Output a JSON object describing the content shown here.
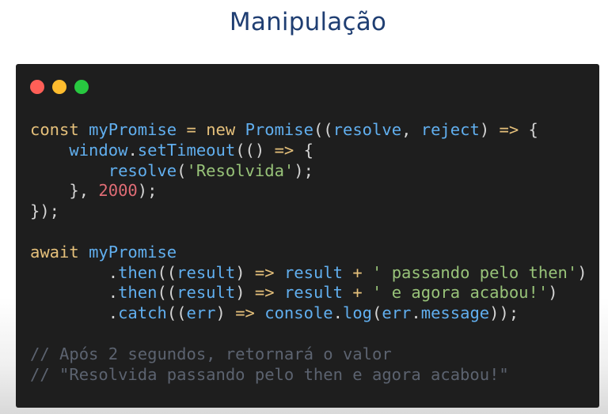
{
  "slide": {
    "title": "Manipulação"
  },
  "window": {
    "controls": {
      "close_color": "#ff5f57",
      "minimize_color": "#febc2e",
      "maximize_color": "#28c840"
    }
  },
  "colors": {
    "title": "#1f3e72",
    "code_background": "#1e1e1e",
    "keyword": "#e5c07b",
    "identifier": "#61afef",
    "string": "#98c379",
    "number": "#e06c75",
    "comment": "#5c6370"
  },
  "code": {
    "lines": [
      [
        {
          "t": "const",
          "c": "kw"
        },
        {
          "t": " ",
          "c": "pun"
        },
        {
          "t": "myPromise",
          "c": "var"
        },
        {
          "t": " ",
          "c": "pun"
        },
        {
          "t": "=",
          "c": "op"
        },
        {
          "t": " ",
          "c": "pun"
        },
        {
          "t": "new",
          "c": "kw"
        },
        {
          "t": " ",
          "c": "pun"
        },
        {
          "t": "Promise",
          "c": "cls"
        },
        {
          "t": "((",
          "c": "pun"
        },
        {
          "t": "resolve",
          "c": "var"
        },
        {
          "t": ", ",
          "c": "pun"
        },
        {
          "t": "reject",
          "c": "var"
        },
        {
          "t": ") ",
          "c": "pun"
        },
        {
          "t": "=>",
          "c": "op"
        },
        {
          "t": " {",
          "c": "pun"
        }
      ],
      [
        {
          "t": "    ",
          "c": "pun"
        },
        {
          "t": "window",
          "c": "var"
        },
        {
          "t": ".",
          "c": "pun"
        },
        {
          "t": "setTimeout",
          "c": "fn"
        },
        {
          "t": "(() ",
          "c": "pun"
        },
        {
          "t": "=>",
          "c": "op"
        },
        {
          "t": " {",
          "c": "pun"
        }
      ],
      [
        {
          "t": "        ",
          "c": "pun"
        },
        {
          "t": "resolve",
          "c": "fn"
        },
        {
          "t": "(",
          "c": "pun"
        },
        {
          "t": "'Resolvida'",
          "c": "str"
        },
        {
          "t": ");",
          "c": "pun"
        }
      ],
      [
        {
          "t": "    }, ",
          "c": "pun"
        },
        {
          "t": "2000",
          "c": "num"
        },
        {
          "t": ");",
          "c": "pun"
        }
      ],
      [
        {
          "t": "});",
          "c": "pun"
        }
      ],
      [],
      [
        {
          "t": "await",
          "c": "kw"
        },
        {
          "t": " ",
          "c": "pun"
        },
        {
          "t": "myPromise",
          "c": "var"
        }
      ],
      [
        {
          "t": "        .",
          "c": "pun"
        },
        {
          "t": "then",
          "c": "fn"
        },
        {
          "t": "((",
          "c": "pun"
        },
        {
          "t": "result",
          "c": "var"
        },
        {
          "t": ") ",
          "c": "pun"
        },
        {
          "t": "=>",
          "c": "op"
        },
        {
          "t": " ",
          "c": "pun"
        },
        {
          "t": "result",
          "c": "var"
        },
        {
          "t": " ",
          "c": "pun"
        },
        {
          "t": "+",
          "c": "op"
        },
        {
          "t": " ",
          "c": "pun"
        },
        {
          "t": "' passando pelo then'",
          "c": "str"
        },
        {
          "t": ")",
          "c": "pun"
        }
      ],
      [
        {
          "t": "        .",
          "c": "pun"
        },
        {
          "t": "then",
          "c": "fn"
        },
        {
          "t": "((",
          "c": "pun"
        },
        {
          "t": "result",
          "c": "var"
        },
        {
          "t": ") ",
          "c": "pun"
        },
        {
          "t": "=>",
          "c": "op"
        },
        {
          "t": " ",
          "c": "pun"
        },
        {
          "t": "result",
          "c": "var"
        },
        {
          "t": " ",
          "c": "pun"
        },
        {
          "t": "+",
          "c": "op"
        },
        {
          "t": " ",
          "c": "pun"
        },
        {
          "t": "' e agora acabou!'",
          "c": "str"
        },
        {
          "t": ")",
          "c": "pun"
        }
      ],
      [
        {
          "t": "        .",
          "c": "pun"
        },
        {
          "t": "catch",
          "c": "fn"
        },
        {
          "t": "((",
          "c": "pun"
        },
        {
          "t": "err",
          "c": "var"
        },
        {
          "t": ") ",
          "c": "pun"
        },
        {
          "t": "=>",
          "c": "op"
        },
        {
          "t": " ",
          "c": "pun"
        },
        {
          "t": "console",
          "c": "var"
        },
        {
          "t": ".",
          "c": "pun"
        },
        {
          "t": "log",
          "c": "fn"
        },
        {
          "t": "(",
          "c": "pun"
        },
        {
          "t": "err",
          "c": "var"
        },
        {
          "t": ".",
          "c": "pun"
        },
        {
          "t": "message",
          "c": "var"
        },
        {
          "t": "));",
          "c": "pun"
        }
      ],
      [],
      [
        {
          "t": "// Após 2 segundos, retornará o valor",
          "c": "com"
        }
      ],
      [
        {
          "t": "// \"Resolvida passando pelo then e agora acabou!\"",
          "c": "com"
        }
      ]
    ]
  }
}
